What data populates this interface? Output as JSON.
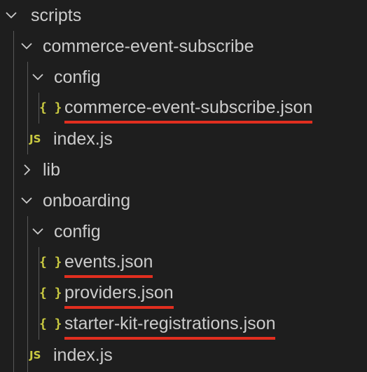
{
  "explorer": {
    "tree": [
      {
        "label": "scripts",
        "kind": "folder",
        "expanded": true,
        "icon": "chevron-down-icon"
      },
      {
        "label": "commerce-event-subscribe",
        "kind": "folder",
        "expanded": true,
        "icon": "chevron-down-icon"
      },
      {
        "label": "config",
        "kind": "folder",
        "expanded": true,
        "icon": "chevron-down-icon"
      },
      {
        "label": "commerce-event-subscribe.json",
        "kind": "file",
        "icon_glyph": "{ }",
        "icon": "json-file-icon",
        "underlined": true
      },
      {
        "label": "index.js",
        "kind": "file",
        "icon_glyph": "JS",
        "icon": "javascript-file-icon"
      },
      {
        "label": "lib",
        "kind": "folder",
        "expanded": false,
        "icon": "chevron-right-icon"
      },
      {
        "label": "onboarding",
        "kind": "folder",
        "expanded": true,
        "icon": "chevron-down-icon"
      },
      {
        "label": "config",
        "kind": "folder",
        "expanded": true,
        "icon": "chevron-down-icon"
      },
      {
        "label": "events.json",
        "kind": "file",
        "icon_glyph": "{ }",
        "icon": "json-file-icon",
        "underlined": true
      },
      {
        "label": "providers.json",
        "kind": "file",
        "icon_glyph": "{ }",
        "icon": "json-file-icon",
        "underlined": true
      },
      {
        "label": "starter-kit-registrations.json",
        "kind": "file",
        "icon_glyph": "{ }",
        "icon": "json-file-icon",
        "underlined": true
      },
      {
        "label": "index.js",
        "kind": "file",
        "icon_glyph": "JS",
        "icon": "javascript-file-icon"
      }
    ]
  },
  "colors": {
    "background": "#1e1e1e",
    "text": "#cccccc",
    "icon_yellow": "#cbcb41",
    "underline_red": "#e12e1f",
    "indent_guide": "#585858"
  }
}
